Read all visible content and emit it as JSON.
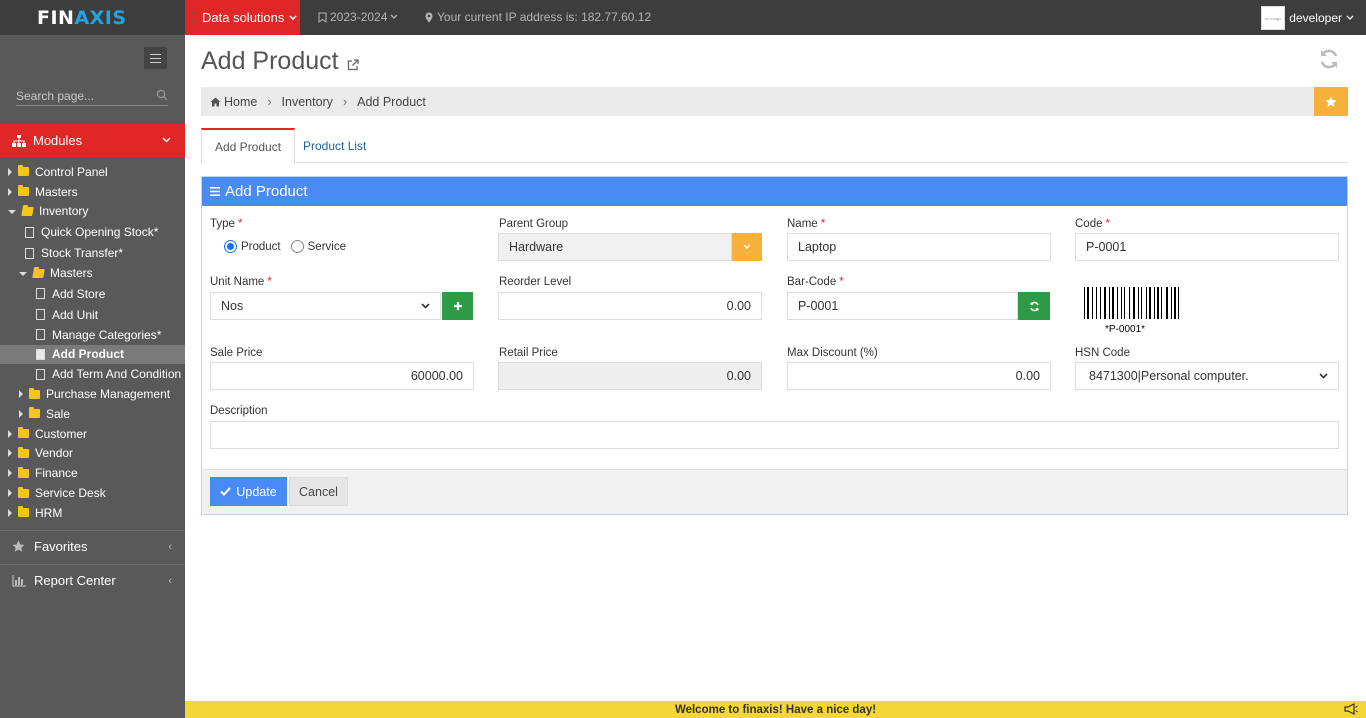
{
  "brand": {
    "part1": "FIN",
    "part2": "AXIS"
  },
  "sidebar": {
    "search_placeholder": "Search page...",
    "modules_label": "Modules",
    "tree": [
      {
        "label": "Control Panel"
      },
      {
        "label": "Masters"
      },
      {
        "label": "Inventory"
      },
      {
        "label": "Quick Opening Stock*"
      },
      {
        "label": "Stock Transfer*"
      },
      {
        "label": "Masters"
      },
      {
        "label": "Add Store"
      },
      {
        "label": "Add Unit"
      },
      {
        "label": "Manage Categories*"
      },
      {
        "label": "Add Product"
      },
      {
        "label": "Add Term And Condition"
      },
      {
        "label": "Purchase Management"
      },
      {
        "label": "Sale"
      },
      {
        "label": "Customer"
      },
      {
        "label": "Vendor"
      },
      {
        "label": "Finance"
      },
      {
        "label": "Service Desk"
      },
      {
        "label": "HRM"
      }
    ],
    "favorites_label": "Favorites",
    "report_center_label": "Report Center"
  },
  "topbar": {
    "data_solutions": "Data solutions",
    "fiscal_year": "2023-2024",
    "ip_text": "Your current IP address is: 182.77.60.12",
    "user": "developer",
    "avatar_text": "no image"
  },
  "page": {
    "title": "Add Product",
    "breadcrumb": {
      "home": "Home",
      "section": "Inventory",
      "current": "Add Product"
    },
    "tabs": {
      "active": "Add Product",
      "other": "Product List"
    }
  },
  "form": {
    "panel_title": "Add Product",
    "type_label": "Type",
    "type_options": {
      "product": "Product",
      "service": "Service"
    },
    "type_selected": "Product",
    "parent_group_label": "Parent Group",
    "parent_group_value": "Hardware",
    "name_label": "Name",
    "name_value": "Laptop",
    "code_label": "Code",
    "code_value": "P-0001",
    "unit_name_label": "Unit Name",
    "unit_name_value": "Nos",
    "reorder_label": "Reorder Level",
    "reorder_value": "0.00",
    "barcode_label": "Bar-Code",
    "barcode_value": "P-0001",
    "barcode_caption": "*P-0001*",
    "sale_price_label": "Sale Price",
    "sale_price_value": "60000.00",
    "retail_price_label": "Retail Price",
    "retail_price_value": "0.00",
    "max_discount_label": "Max Discount (%)",
    "max_discount_value": "0.00",
    "hsn_label": "HSN Code",
    "hsn_value": "8471300|Personal computer.",
    "description_label": "Description",
    "description_value": "",
    "update_label": "Update",
    "cancel_label": "Cancel"
  },
  "footer": {
    "welcome": "Welcome to finaxis! Have a nice day!"
  },
  "colors": {
    "accent_red": "#e02727",
    "primary_blue": "#4a8af4",
    "warning_orange": "#f6b13a",
    "success_green": "#2e9b46",
    "notice_yellow": "#f5d638"
  }
}
